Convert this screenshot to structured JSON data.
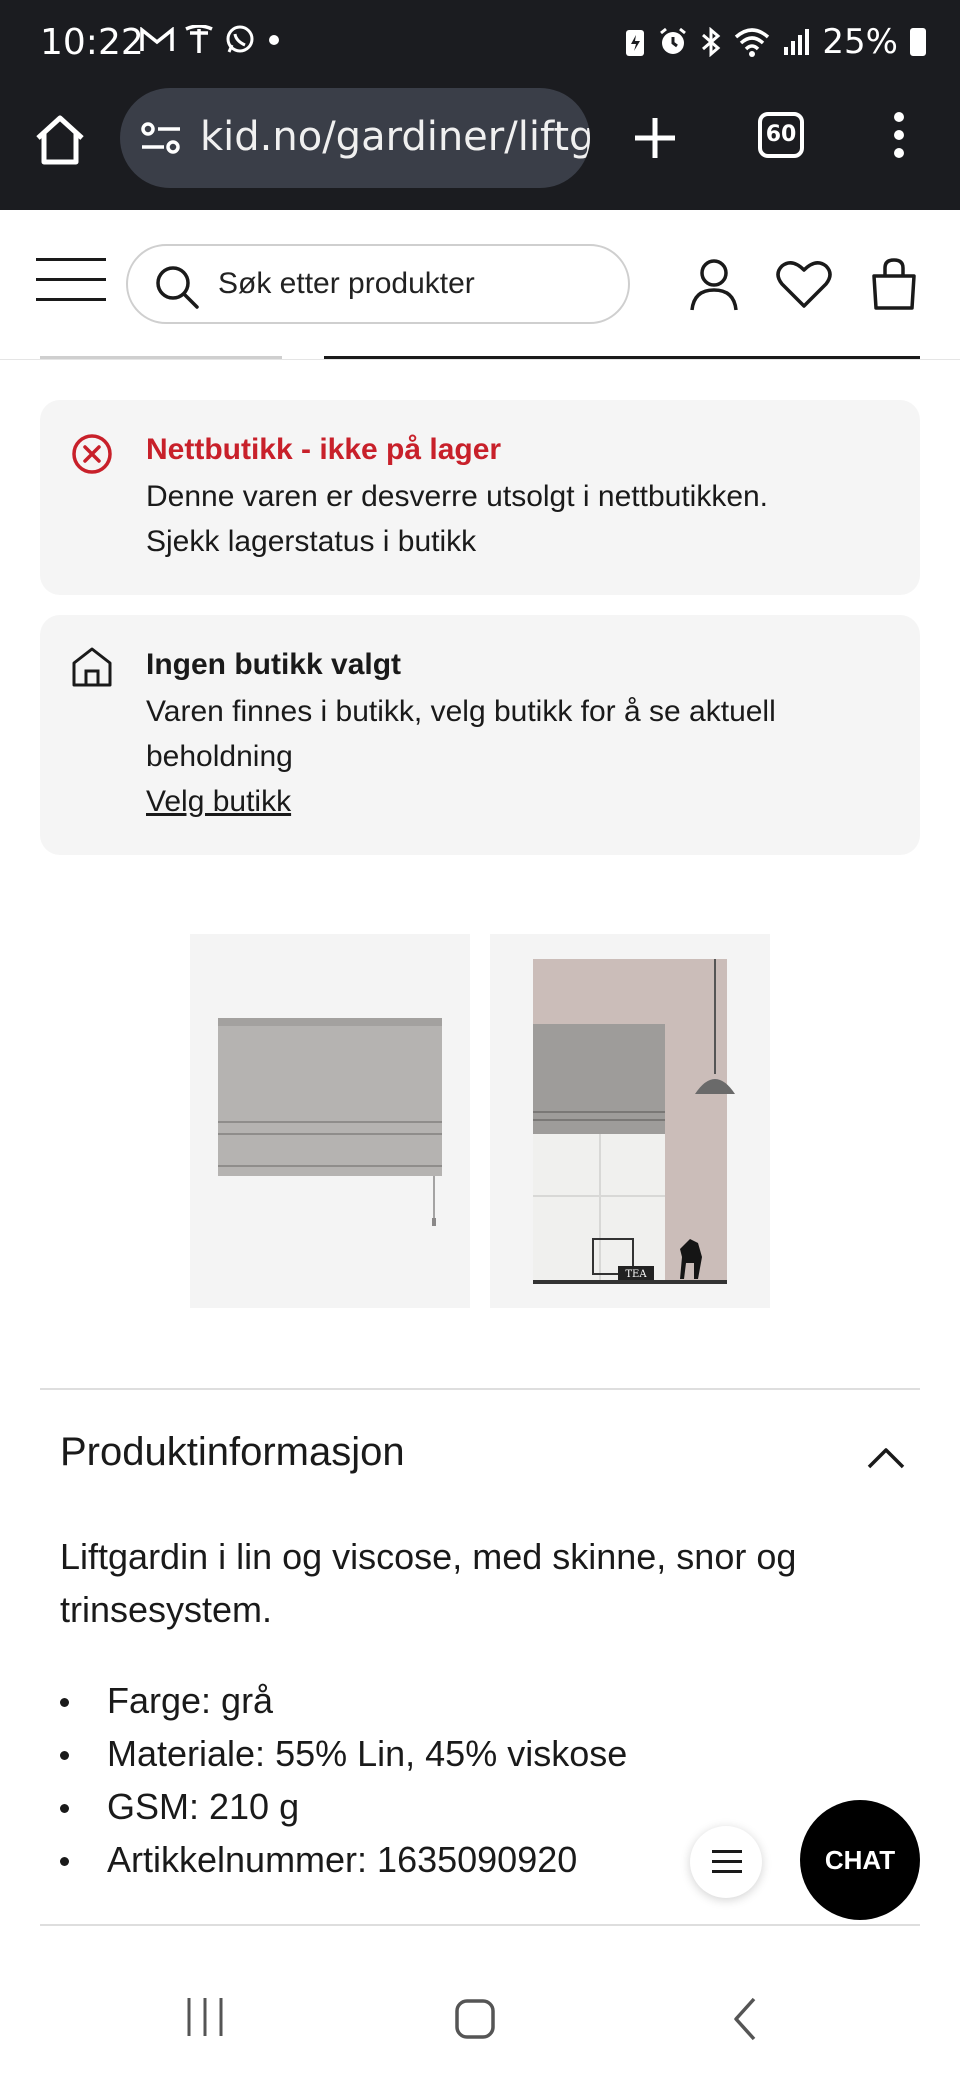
{
  "status_bar": {
    "time": "10:22",
    "notification_icons": [
      "gmail-icon",
      "tesla-icon",
      "whatsapp-icon",
      "dot-icon"
    ],
    "system_icons": [
      "battery-saver-icon",
      "alarm-icon",
      "bluetooth-icon",
      "wifi-icon",
      "signal-icon"
    ],
    "battery": "25%"
  },
  "browser": {
    "url": "kid.no/gardiner/liftg",
    "tab_count": "60"
  },
  "header": {
    "search_placeholder": "Søk etter produkter"
  },
  "stock_card": {
    "title": "Nettbutikk - ikke på lager",
    "line1": "Denne varen er desverre utsolgt i nettbutikken.",
    "line2": "Sjekk lagerstatus i butikk"
  },
  "store_card": {
    "title": "Ingen butikk valgt",
    "text": "Varen finnes i butikk, velg butikk for å se aktuell beholdning",
    "link": "Velg butikk"
  },
  "product_images": {
    "second_image_label": "TEA"
  },
  "product_info": {
    "heading": "Produktinformasjon",
    "description": "Liftgardin i lin og viscose, med skinne, snor og trinsesystem.",
    "specs": [
      "Farge: grå",
      "Materiale: 55% Lin, 45% viskose",
      "GSM: 210 g",
      "Artikkelnummer: 1635090920"
    ]
  },
  "chat": {
    "label": "CHAT"
  },
  "colors": {
    "error_red": "#c8202a",
    "card_bg": "#f5f5f5",
    "browser_chrome": "#1b1c20"
  }
}
